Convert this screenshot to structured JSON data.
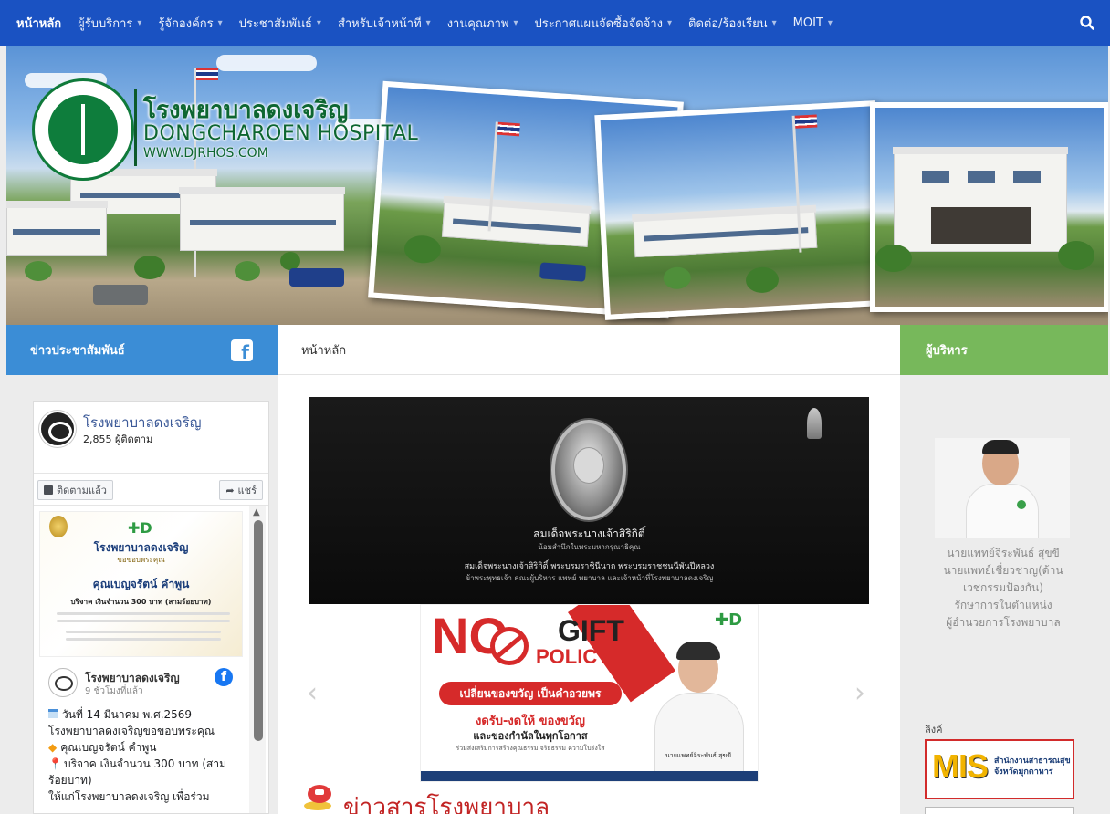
{
  "nav": {
    "items": [
      {
        "label": "หน้าหลัก",
        "dropdown": false,
        "active": true
      },
      {
        "label": "ผู้รับบริการ",
        "dropdown": true
      },
      {
        "label": "รู้จักองค์กร",
        "dropdown": true
      },
      {
        "label": "ประชาสัมพันธ์",
        "dropdown": true
      },
      {
        "label": "สำหรับเจ้าหน้าที่",
        "dropdown": true
      },
      {
        "label": "งานคุณภาพ",
        "dropdown": true
      },
      {
        "label": "ประกาศแผนจัดซื้อจัดจ้าง",
        "dropdown": true
      },
      {
        "label": "ติดต่อ/ร้องเรียน",
        "dropdown": true
      },
      {
        "label": "MOIT",
        "dropdown": true
      }
    ],
    "caret": "▾",
    "search_icon": "search-icon",
    "color": "#1a52c2"
  },
  "banner": {
    "hospital_name_th": "โรงพยาบาลดงเจริญ",
    "hospital_name_en": "DONGCHAROEN HOSPITAL",
    "website": "WWW.DJRHOS.COM"
  },
  "left_panel": {
    "title": "ข่าวประชาสัมพันธ์",
    "header_color": "#3b8dd6",
    "facebook_icon": "facebook-icon",
    "fb": {
      "page_name": "โรงพยาบาลดงเจริญ",
      "followers": "2,855 ผู้ติดตาม",
      "follow_button": "ติดตามแล้ว",
      "share_button": "แชร์",
      "post": {
        "image_hospital": "โรงพยาบาลดงเจริญ",
        "image_thanks": "ขอขอบพระคุณ",
        "image_donor": "คุณเบญจรัตน์ คำพูน",
        "image_donation": "บริจาค เงินจำนวน 300 บาท (สามร้อยบาท)",
        "author": "โรงพยาบาลดงเจริญ",
        "time": "9 ชั่วโมงที่แล้ว",
        "lines": [
          "วันที่ 14 มีนาคม พ.ศ.2569",
          "โรงพยาบาลดงเจริญขอขอบพระคุณ",
          "คุณเบญจรัตน์ คำพูน",
          "บริจาค เงินจำนวน 300 บาท (สาม",
          "ร้อยบาท)",
          "ให้แก่โรงพยาบาลดงเจริญ เพื่อร่วม"
        ]
      }
    }
  },
  "main": {
    "breadcrumb": "หน้าหลัก",
    "slide1": {
      "title": "สมเด็จพระนางเจ้าสิริกิติ์",
      "subtitle": "น้อมสำนึกในพระมหากรุณาธิคุณ",
      "line1": "สมเด็จพระนางเจ้าสิริกิติ์ พระบรมราชินีนาถ พระบรมราชชนนีพันปีหลวง",
      "line2": "ข้าพระพุทธเจ้า คณะผู้บริหาร แพทย์ พยาบาล และเจ้าหน้าที่โรงพยาบาลดงเจริญ"
    },
    "slide2": {
      "no": "NO",
      "gift": "GIFT",
      "policy": "POLICY",
      "banner": "เปลี่ยนของขวัญ เป็นคำอวยพร",
      "line1": "งดรับ-งดให้ ของขวัญ",
      "line2": "และของกำนัลในทุกโอกาส",
      "line3": "ร่วมส่งเสริมการสร้างคุณธรรม จริยธรรม ความโปร่งใส",
      "caption": "นายแพทย์จิระพันธ์ สุขขี"
    },
    "slider_prev": "‹",
    "slider_next": "›",
    "news_title": "ข่าวสารโรงพยาบาล"
  },
  "right_panel": {
    "title": "ผู้บริหาร",
    "header_color": "#77b85b",
    "director_lines": [
      "นายแพทย์จิระพันธ์ สุขขี",
      "นายแพทย์เชี่ยวชาญ(ด้าน",
      "เวชกรรมป้องกัน)",
      "รักษาการในตำแหน่ง",
      "ผู้อำนวยการโรงพยาบาล"
    ],
    "links_label": "ลิงค์",
    "mis": {
      "logo": "MIS",
      "sub1": "สำนักงานสาธารณสุข",
      "sub2": "จังหวัดมุกดาหาร"
    }
  }
}
